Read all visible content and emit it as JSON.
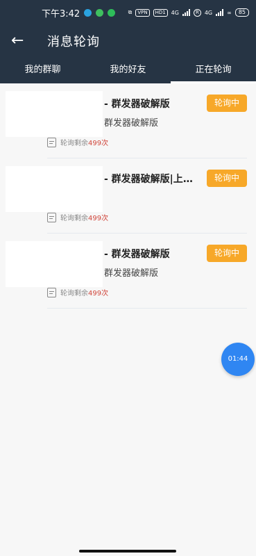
{
  "status_bar": {
    "time": "下午3:42",
    "vpn": "VPN",
    "hd": "HD1",
    "net1": "4G",
    "r": "R",
    "net2": "4G",
    "battery": "85"
  },
  "header": {
    "title": "消息轮询",
    "back_icon": "back-arrow-icon"
  },
  "tabs": [
    {
      "label": "我的群聊",
      "active": false
    },
    {
      "label": "我的好友",
      "active": false
    },
    {
      "label": "正在轮询",
      "active": true
    }
  ],
  "items": [
    {
      "title": "- 群发器破解版",
      "subtitle": "群发器破解版",
      "badge": "轮询中",
      "remain_label": "轮询剩余",
      "remain_count": "499次"
    },
    {
      "title": "- 群发器破解版|上粉...",
      "subtitle": "",
      "badge": "轮询中",
      "remain_label": "轮询剩余",
      "remain_count": "499次"
    },
    {
      "title": "- 群发器破解版",
      "subtitle": "群发器破解版",
      "badge": "轮询中",
      "remain_label": "轮询剩余",
      "remain_count": "499次"
    }
  ],
  "timer": "01:44",
  "colors": {
    "header_bg": "#263444",
    "badge_bg": "#f7a829",
    "count_text": "#d0463b",
    "fab_bg": "#2f86f2"
  }
}
